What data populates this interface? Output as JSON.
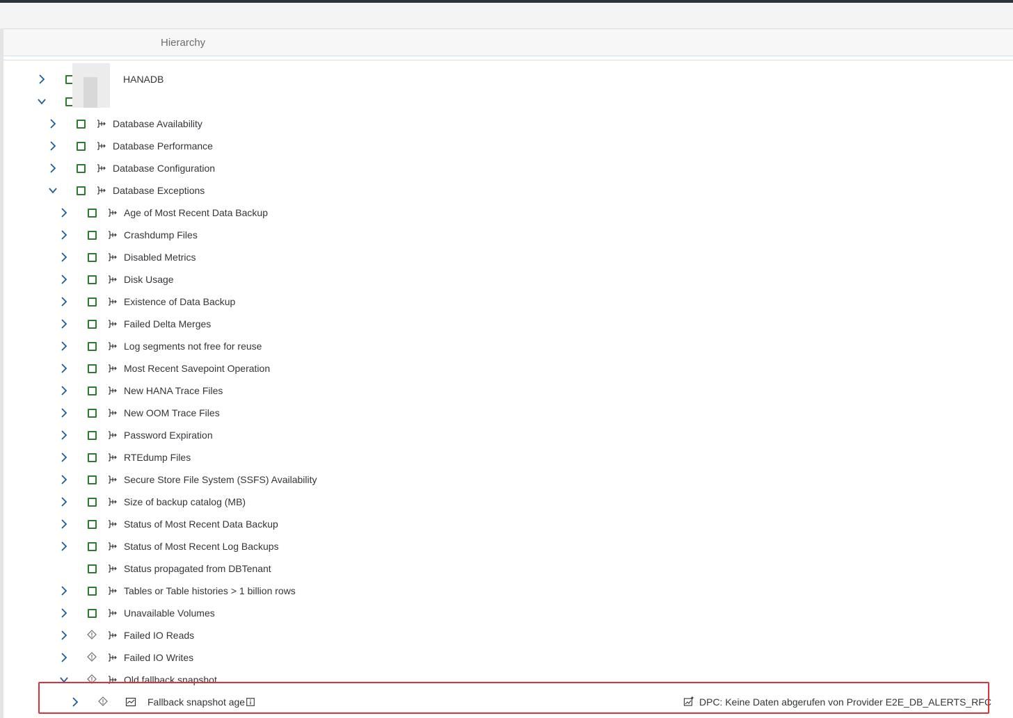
{
  "header": {
    "title": "Hierarchy"
  },
  "tree": [
    {
      "label": "HANADB",
      "level": 0,
      "expand": "collapsed",
      "status": "square",
      "type_icon": "none"
    },
    {
      "label": "",
      "level": 0,
      "expand": "expanded",
      "status": "square",
      "type_icon": "none"
    },
    {
      "label": "Database Availability",
      "level": 1,
      "expand": "collapsed",
      "status": "square",
      "type_icon": "category"
    },
    {
      "label": "Database Performance",
      "level": 1,
      "expand": "collapsed",
      "status": "square",
      "type_icon": "category"
    },
    {
      "label": "Database Configuration",
      "level": 1,
      "expand": "collapsed",
      "status": "square",
      "type_icon": "category"
    },
    {
      "label": "Database Exceptions",
      "level": 1,
      "expand": "expanded",
      "status": "square",
      "type_icon": "category"
    },
    {
      "label": "Age of Most Recent Data Backup",
      "level": 2,
      "expand": "collapsed",
      "status": "square",
      "type_icon": "category"
    },
    {
      "label": "Crashdump Files",
      "level": 2,
      "expand": "collapsed",
      "status": "square",
      "type_icon": "category"
    },
    {
      "label": "Disabled Metrics",
      "level": 2,
      "expand": "collapsed",
      "status": "square",
      "type_icon": "category"
    },
    {
      "label": "Disk Usage",
      "level": 2,
      "expand": "collapsed",
      "status": "square",
      "type_icon": "category"
    },
    {
      "label": "Existence of Data Backup",
      "level": 2,
      "expand": "collapsed",
      "status": "square",
      "type_icon": "category"
    },
    {
      "label": "Failed Delta Merges",
      "level": 2,
      "expand": "collapsed",
      "status": "square",
      "type_icon": "category"
    },
    {
      "label": "Log segments not free for reuse",
      "level": 2,
      "expand": "collapsed",
      "status": "square",
      "type_icon": "category"
    },
    {
      "label": "Most Recent Savepoint Operation",
      "level": 2,
      "expand": "collapsed",
      "status": "square",
      "type_icon": "category"
    },
    {
      "label": "New HANA Trace Files",
      "level": 2,
      "expand": "collapsed",
      "status": "square",
      "type_icon": "category"
    },
    {
      "label": "New OOM Trace Files",
      "level": 2,
      "expand": "collapsed",
      "status": "square",
      "type_icon": "category"
    },
    {
      "label": "Password Expiration",
      "level": 2,
      "expand": "collapsed",
      "status": "square",
      "type_icon": "category"
    },
    {
      "label": "RTEdump Files",
      "level": 2,
      "expand": "collapsed",
      "status": "square",
      "type_icon": "category"
    },
    {
      "label": "Secure Store File System (SSFS) Availability",
      "level": 2,
      "expand": "collapsed",
      "status": "square",
      "type_icon": "category"
    },
    {
      "label": "Size of backup catalog (MB)",
      "level": 2,
      "expand": "collapsed",
      "status": "square",
      "type_icon": "category"
    },
    {
      "label": "Status of Most Recent Data Backup",
      "level": 2,
      "expand": "collapsed",
      "status": "square",
      "type_icon": "category"
    },
    {
      "label": "Status of Most Recent Log Backups",
      "level": 2,
      "expand": "collapsed",
      "status": "square",
      "type_icon": "category"
    },
    {
      "label": "Status propagated from DBTenant",
      "level": 2,
      "expand": "none",
      "status": "square",
      "type_icon": "category"
    },
    {
      "label": "Tables or Table histories > 1 billion rows",
      "level": 2,
      "expand": "collapsed",
      "status": "square",
      "type_icon": "category"
    },
    {
      "label": "Unavailable Volumes",
      "level": 2,
      "expand": "collapsed",
      "status": "square",
      "type_icon": "category"
    },
    {
      "label": "Failed IO Reads",
      "level": 2,
      "expand": "collapsed",
      "status": "diamond",
      "type_icon": "category"
    },
    {
      "label": "Failed IO Writes",
      "level": 2,
      "expand": "collapsed",
      "status": "diamond",
      "type_icon": "category"
    },
    {
      "label": "Old fallback snapshot",
      "level": 2,
      "expand": "expanded",
      "status": "diamond",
      "type_icon": "category"
    },
    {
      "label": "Fallback snapshot age",
      "level": 3,
      "expand": "collapsed",
      "status": "diamond",
      "type_icon": "metric",
      "has_info": true,
      "message": "DPC: Keine Daten abgerufen von Provider E2E_DB_ALERTS_RFC"
    }
  ],
  "colors": {
    "ok": "#2b7d2b",
    "chevron": "#0a6ed1",
    "highlight": "#e0303a"
  }
}
